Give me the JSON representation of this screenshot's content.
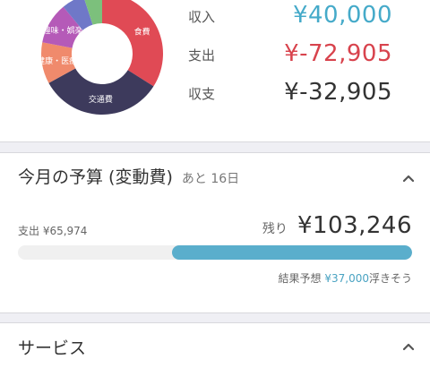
{
  "summary": {
    "donut_slices": [
      {
        "name": "食費",
        "share": 0.34,
        "color": "#e04a55"
      },
      {
        "name": "交通費",
        "share": 0.33,
        "color": "#3d3a5c"
      },
      {
        "name": "健康・医療",
        "share": 0.11,
        "color": "#f08a6c"
      },
      {
        "name": "趣味・娯楽",
        "share": 0.11,
        "color": "#b55ab8"
      },
      {
        "name": "",
        "share": 0.06,
        "color": "#6f78c8"
      },
      {
        "name": "",
        "share": 0.05,
        "color": "#7cc07c"
      }
    ],
    "income_label": "収入",
    "income_value": "¥40,000",
    "income_color": "#45aac9",
    "expense_label": "支出",
    "expense_value": "¥-72,905",
    "expense_color": "#d8434d",
    "balance_label": "収支",
    "balance_value": "¥-32,905",
    "balance_color": "#333333"
  },
  "budget": {
    "title": "今月の予算 (変動費)",
    "days_left": "あと 16日",
    "collapse_icon": "chevron-up-icon",
    "spent_text": "支出 ¥65,974",
    "remaining_label": "残り",
    "remaining_value": "¥103,246",
    "remaining_fraction": 0.61,
    "forecast_prefix": "結果予想",
    "forecast_amount": "¥37,000",
    "forecast_suffix": "浮きそう"
  },
  "service": {
    "title": "サービス",
    "collapse_icon": "chevron-up-icon"
  }
}
